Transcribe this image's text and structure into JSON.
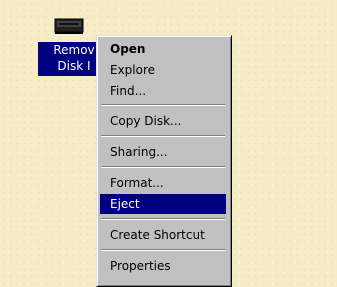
{
  "desktop": {
    "icon": {
      "name": "drive-icon",
      "label_line1": "Remov",
      "label_line2": "Disk I"
    }
  },
  "context_menu": {
    "items": [
      {
        "label": "Open",
        "bold": true
      },
      {
        "label": "Explore"
      },
      {
        "label": "Find..."
      },
      {
        "label": "Copy Disk..."
      },
      {
        "label": "Sharing..."
      },
      {
        "label": "Format..."
      },
      {
        "label": "Eject",
        "selected": true
      },
      {
        "label": "Create Shortcut"
      },
      {
        "label": "Properties"
      }
    ]
  },
  "colors": {
    "desktop_bg": "#f6edc7",
    "menu_bg": "#c0c0c0",
    "selection": "#000080"
  }
}
